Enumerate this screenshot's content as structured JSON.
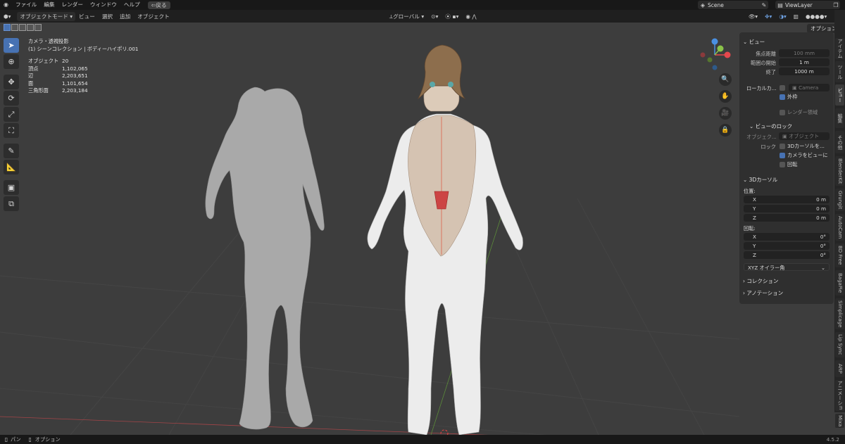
{
  "topbar": {
    "menus": [
      "ファイル",
      "編集",
      "レンダー",
      "ウィンドウ",
      "ヘルプ"
    ],
    "back_label": "戻る",
    "scene_name": "Scene",
    "view_layer": "ViewLayer"
  },
  "header": {
    "mode": "オブジェクトモード",
    "menus": [
      "ビュー",
      "選択",
      "追加",
      "オブジェクト"
    ],
    "transform_orientation": "グローバル",
    "options_label": "オプション"
  },
  "viewport": {
    "view_name": "カメラ・透視投影",
    "collection_line": "(1) シーンコレクション | ボディーハイポリ.001",
    "stats": [
      {
        "label": "オブジェクト",
        "value": "20"
      },
      {
        "label": "頂点",
        "value": "1,102,065"
      },
      {
        "label": "辺",
        "value": "2,203,651"
      },
      {
        "label": "面",
        "value": "1,101,654"
      },
      {
        "label": "三角形面",
        "value": "2,203,184"
      }
    ]
  },
  "npanel": {
    "view_header": "ビュー",
    "focal_label": "焦点距離",
    "focal_value": "100 mm",
    "clip_start_label": "範囲の開始",
    "clip_start_value": "1 m",
    "clip_end_label": "終了",
    "clip_end_value": "1000 m",
    "local_camera_label": "ローカルカ...",
    "camera_value": "Camera",
    "outer_frame_label": "外枠",
    "render_region_label": "レンダー領域",
    "view_lock_header": "ビューのロック",
    "lock_object_label": "オブジェク...",
    "lock_object_placeholder": "オブジェクト",
    "lock_label": "ロック",
    "lock_cursor_label": "3Dカーソルを...",
    "camera_to_view_label": "カメラをビューに",
    "rotation_label": "回転",
    "cursor_header": "3Dカーソル",
    "location_label": "位置:",
    "loc": [
      {
        "axis": "X",
        "value": "0 m"
      },
      {
        "axis": "Y",
        "value": "0 m"
      },
      {
        "axis": "Z",
        "value": "0 m"
      }
    ],
    "rotation_section_label": "回転:",
    "rot": [
      {
        "axis": "X",
        "value": "0°"
      },
      {
        "axis": "Y",
        "value": "0°"
      },
      {
        "axis": "Z",
        "value": "0°"
      }
    ],
    "rot_mode": "XYZ オイラー角",
    "collection_header": "コレクション",
    "annotation_header": "アノテーション"
  },
  "side_tabs": [
    "アイテム",
    "ツール",
    "ビュー",
    "編集",
    "その他",
    "BlenderKit",
    "Grungit",
    "AutoCam",
    "BD Free",
    "BagaPie",
    "Simplicage",
    "Lip Sync",
    "ARP",
    "アニメーション",
    "Mixa"
  ],
  "status": {
    "pan": "パン",
    "options": "オプション",
    "version": "4.5.2"
  },
  "colors": {
    "accent": "#4772b3",
    "x_axis": "#e5484d",
    "y_axis": "#8bc34a",
    "z_axis": "#4a90e2",
    "viewport_bg": "#3d3d3d"
  }
}
